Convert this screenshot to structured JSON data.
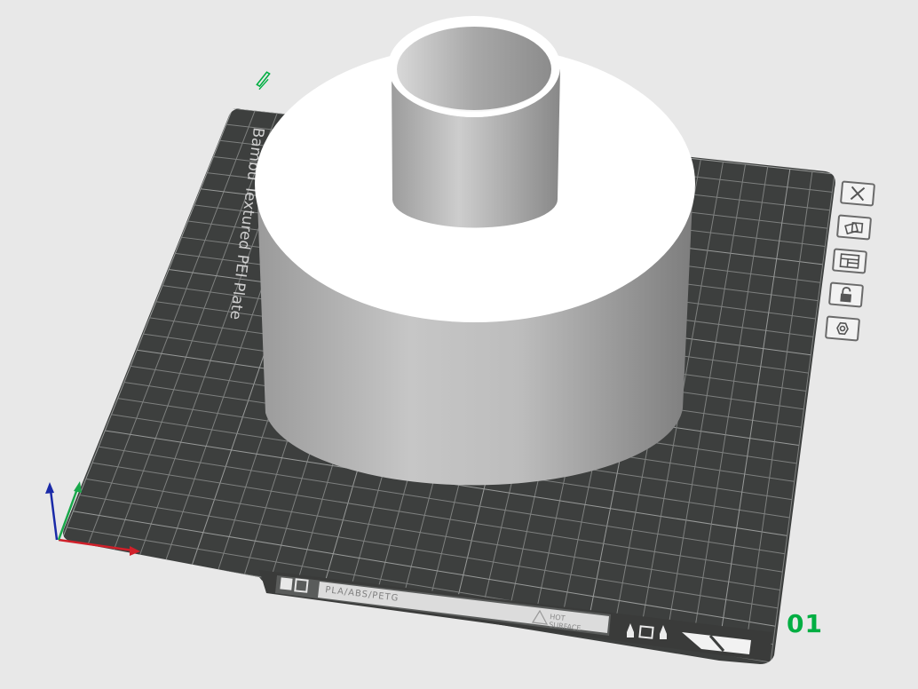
{
  "plate": {
    "name": "Bambu Textured PEI Plate",
    "material_label": "PLA/ABS/PETG",
    "hot_surface_label_1": "HOT",
    "hot_surface_label_2": "SURFACE",
    "number": "01"
  },
  "toolbar": {
    "buttons": [
      {
        "id": "delete",
        "icon": "close-icon"
      },
      {
        "id": "arrange",
        "icon": "arrange-icon"
      },
      {
        "id": "orient",
        "icon": "layout-icon"
      },
      {
        "id": "lock",
        "icon": "lock-icon"
      },
      {
        "id": "settings",
        "icon": "hex-settings-icon"
      }
    ]
  },
  "axes": {
    "x_color": "#d0202a",
    "y_color": "#19a84a",
    "z_color": "#1a2aa8"
  },
  "colors": {
    "plate": "#3d3f3e",
    "grid": "#8a8c8b",
    "accent": "#00ae42",
    "model": "#f3f3f3"
  }
}
